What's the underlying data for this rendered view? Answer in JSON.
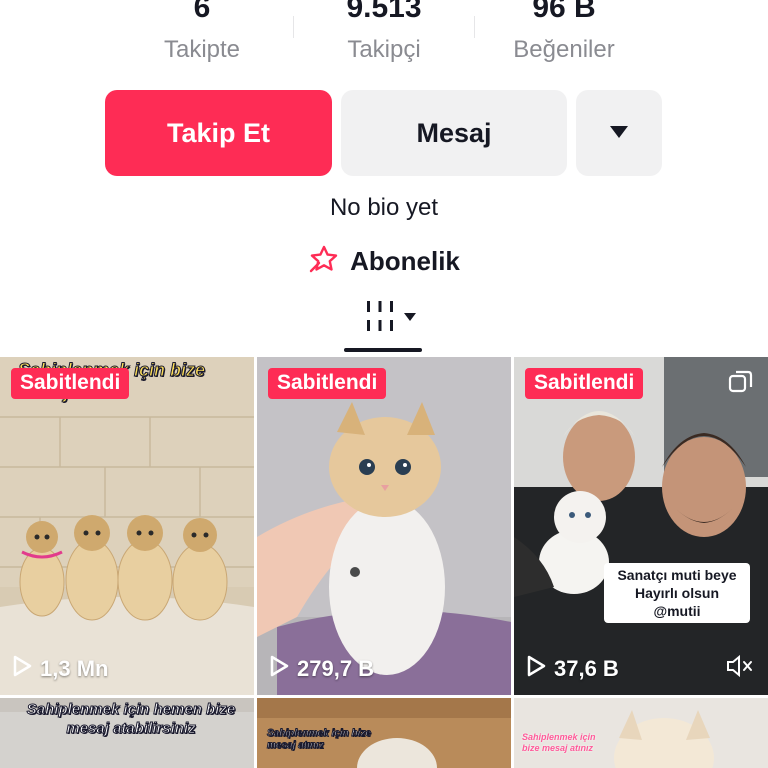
{
  "profile": {
    "stats": [
      {
        "value": "6",
        "label": "Takipte"
      },
      {
        "value": "9.513",
        "label": "Takipçi"
      },
      {
        "value": "96 B",
        "label": "Beğeniler"
      }
    ],
    "follow_label": "Takip Et",
    "message_label": "Mesaj",
    "bio": "No bio yet",
    "subscription_label": "Abonelik"
  },
  "colors": {
    "accent": "#fe2c55",
    "button_grey": "#f1f1f2",
    "text_primary": "#161823",
    "text_secondary": "#8a8b91"
  },
  "videos": [
    {
      "pinned_label": "Sabitlendi",
      "views": "1,3 Mn",
      "overlay_text": "Sahiplenmek için bize mesaj atınız"
    },
    {
      "pinned_label": "Sabitlendi",
      "views": "279,7 B",
      "overlay_text": ""
    },
    {
      "pinned_label": "Sabitlendi",
      "views": "37,6 B",
      "overlay_text": "Sanatçı muti beye Hayırlı olsun @mutii",
      "muted": true,
      "multi_icon": true
    },
    {
      "pinned_label": "",
      "views": "",
      "overlay_text": "Sahiplenmek için hemen bize mesaj atabilirsiniz"
    },
    {
      "pinned_label": "",
      "views": "",
      "overlay_text": "Sahiplenmek için bize mesaj atınız"
    },
    {
      "pinned_label": "",
      "views": "",
      "overlay_text": "Sahiplenmek için bize mesaj atınız"
    }
  ]
}
